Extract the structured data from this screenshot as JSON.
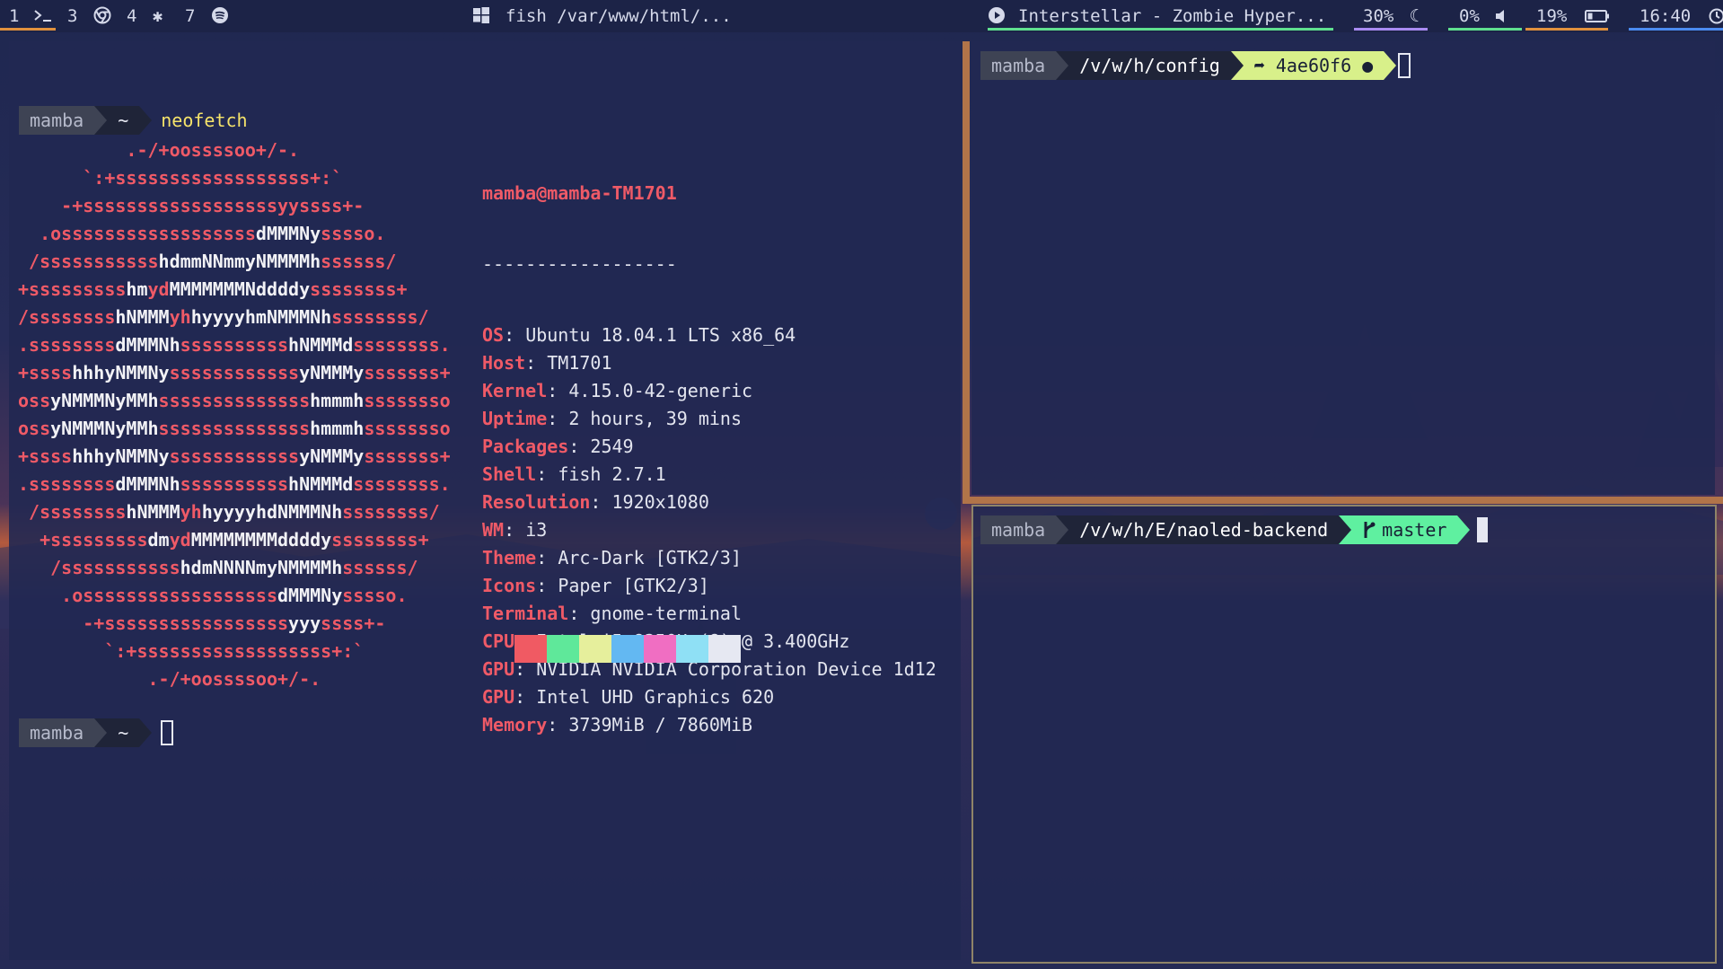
{
  "topbar": {
    "workspaces": [
      {
        "num": "1",
        "icon": "terminal-icon",
        "active": true
      },
      {
        "num": "3",
        "icon": "chrome-icon",
        "active": false
      },
      {
        "num": "4",
        "icon": "gear-icon",
        "active": false
      },
      {
        "num": "7",
        "icon": "spotify-icon",
        "active": false
      }
    ],
    "window_title": "fish  /var/www/html/...",
    "media": "Interstellar - Zombie Hyper...",
    "brightness": "30%",
    "volume": "0%",
    "battery": "19%",
    "clock": "16:40",
    "colors": {
      "ws_active": "#e1913d",
      "media_ul": "#5fe08f",
      "brightness_ul": "#a98bf2",
      "volume_ul": "#5fe08f",
      "battery_ul": "#e1913d",
      "clock_ul": "#4b8bf0"
    }
  },
  "left_term": {
    "prompt1": {
      "user": "mamba",
      "dir": "~",
      "command": "neofetch"
    },
    "ascii_art": [
      [
        [
          "r",
          "          .-/+oossssoo+/-."
        ]
      ],
      [
        [
          "r",
          "      `:+ssssssssssssssssss+:`"
        ]
      ],
      [
        [
          "r",
          "    -+ssssssssssssssssssyyssss+-"
        ]
      ],
      [
        [
          "r",
          "  .ossssssssssssssssss"
        ],
        [
          "w",
          "dMMMNy"
        ],
        [
          "r",
          "sssso."
        ]
      ],
      [
        [
          "r",
          " /sssssssssss"
        ],
        [
          "w",
          "hdmmNNmmyNMMMMh"
        ],
        [
          "r",
          "ssssss/"
        ]
      ],
      [
        [
          "r",
          "+sssssssss"
        ],
        [
          "w",
          "hm"
        ],
        [
          "r",
          "yd"
        ],
        [
          "w",
          "MMMMMMMNddddy"
        ],
        [
          "r",
          "ssssssss+"
        ]
      ],
      [
        [
          "r",
          "/ssssssss"
        ],
        [
          "w",
          "hNMMM"
        ],
        [
          "r",
          "yh"
        ],
        [
          "w",
          "hyyyyhmNMMMNh"
        ],
        [
          "r",
          "ssssssss/"
        ]
      ],
      [
        [
          "r",
          ".ssssssss"
        ],
        [
          "w",
          "dMMMNh"
        ],
        [
          "r",
          "ssssssssss"
        ],
        [
          "w",
          "hNMMMd"
        ],
        [
          "r",
          "ssssssss."
        ]
      ],
      [
        [
          "r",
          "+ssss"
        ],
        [
          "w",
          "hhhyNMMNy"
        ],
        [
          "r",
          "ssssssssssss"
        ],
        [
          "w",
          "yNMMMy"
        ],
        [
          "r",
          "sssssss+"
        ]
      ],
      [
        [
          "r",
          "oss"
        ],
        [
          "w",
          "yNMMMNyMMh"
        ],
        [
          "r",
          "ssssssssssssss"
        ],
        [
          "w",
          "hmmmh"
        ],
        [
          "r",
          "ssssssso"
        ]
      ],
      [
        [
          "r",
          "oss"
        ],
        [
          "w",
          "yNMMMNyMMh"
        ],
        [
          "r",
          "ssssssssssssss"
        ],
        [
          "w",
          "hmmmh"
        ],
        [
          "r",
          "ssssssso"
        ]
      ],
      [
        [
          "r",
          "+ssss"
        ],
        [
          "w",
          "hhhyNMMNy"
        ],
        [
          "r",
          "ssssssssssss"
        ],
        [
          "w",
          "yNMMMy"
        ],
        [
          "r",
          "sssssss+"
        ]
      ],
      [
        [
          "r",
          ".ssssssss"
        ],
        [
          "w",
          "dMMMNh"
        ],
        [
          "r",
          "ssssssssss"
        ],
        [
          "w",
          "hNMMMd"
        ],
        [
          "r",
          "ssssssss."
        ]
      ],
      [
        [
          "r",
          " /ssssssss"
        ],
        [
          "w",
          "hNMMM"
        ],
        [
          "r",
          "yh"
        ],
        [
          "w",
          "hyyyyhdNMMMNh"
        ],
        [
          "r",
          "ssssssss/"
        ]
      ],
      [
        [
          "r",
          "  +sssssssss"
        ],
        [
          "w",
          "dm"
        ],
        [
          "r",
          "yd"
        ],
        [
          "w",
          "MMMMMMMMddddy"
        ],
        [
          "r",
          "ssssssss+"
        ]
      ],
      [
        [
          "r",
          "   /sssssssssss"
        ],
        [
          "w",
          "hdmNNNNmyNMMMMh"
        ],
        [
          "r",
          "ssssss/"
        ]
      ],
      [
        [
          "r",
          "    .ossssssssssssssssss"
        ],
        [
          "w",
          "dMMMNy"
        ],
        [
          "r",
          "sssso."
        ]
      ],
      [
        [
          "r",
          "      -+sssssssssssssssss"
        ],
        [
          "w",
          "yyy"
        ],
        [
          "r",
          "ssss+-"
        ]
      ],
      [
        [
          "r",
          "        `:+ssssssssssssssssss+:`"
        ]
      ],
      [
        [
          "r",
          "            .-/+oossssoo+/-."
        ]
      ]
    ],
    "info": {
      "userhost": "mamba@mamba-TM1701",
      "separator": "------------------",
      "rows": [
        {
          "key": "OS",
          "value": "Ubuntu 18.04.1 LTS x86_64"
        },
        {
          "key": "Host",
          "value": "TM1701"
        },
        {
          "key": "Kernel",
          "value": "4.15.0-42-generic"
        },
        {
          "key": "Uptime",
          "value": "2 hours, 39 mins"
        },
        {
          "key": "Packages",
          "value": "2549"
        },
        {
          "key": "Shell",
          "value": "fish 2.7.1"
        },
        {
          "key": "Resolution",
          "value": "1920x1080"
        },
        {
          "key": "WM",
          "value": "i3"
        },
        {
          "key": "Theme",
          "value": "Arc-Dark [GTK2/3]"
        },
        {
          "key": "Icons",
          "value": "Paper [GTK2/3]"
        },
        {
          "key": "Terminal",
          "value": "gnome-terminal"
        },
        {
          "key": "CPU",
          "value": "Intel i5-8250U (8) @ 3.400GHz"
        },
        {
          "key": "GPU",
          "value": "NVIDIA NVIDIA Corporation Device 1d12"
        },
        {
          "key": "GPU",
          "value": "Intel UHD Graphics 620"
        },
        {
          "key": "Memory",
          "value": "3739MiB / 7860MiB"
        }
      ],
      "palette": [
        "#f05a63",
        "#5fe89a",
        "#e6ef9c",
        "#63b8f2",
        "#f06ec2",
        "#8fe0f5",
        "#e6e8f2"
      ]
    },
    "prompt2": {
      "user": "mamba",
      "dir": "~"
    }
  },
  "right_top_term": {
    "user": "mamba",
    "dir": "/v/w/h/config",
    "git": "➦ 4ae60f6 ●"
  },
  "right_bottom_term": {
    "user": "mamba",
    "dir": "/v/w/h/E/naoled-backend",
    "git_branch": "master"
  }
}
